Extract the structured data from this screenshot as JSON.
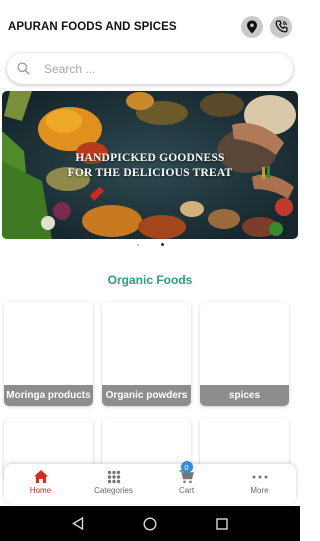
{
  "header": {
    "title": "APURAN FOODS AND SPICES"
  },
  "search": {
    "placeholder": "Search ..."
  },
  "banner": {
    "line1": "HANDPICKED GOODNESS",
    "line2": "FOR THE DELICIOUS TREAT"
  },
  "section": {
    "title": "Organic Foods"
  },
  "categories": [
    {
      "label": "Moringa products"
    },
    {
      "label": "Organic powders"
    },
    {
      "label": "spices"
    }
  ],
  "nav": {
    "home": "Home",
    "categories": "Categories",
    "cart": "Cart",
    "cart_count": "0",
    "more": "More"
  },
  "colors": {
    "accent": "#2f9a86",
    "active_nav": "#d52a1e",
    "badge": "#2f8fd6",
    "label_bg": "#8d8d8d"
  },
  "icons": [
    "location-pin-icon",
    "phone-icon",
    "search-icon",
    "home-icon",
    "grid-icon",
    "cart-icon",
    "more-icon",
    "back-icon",
    "home-circle-icon",
    "recents-icon"
  ]
}
